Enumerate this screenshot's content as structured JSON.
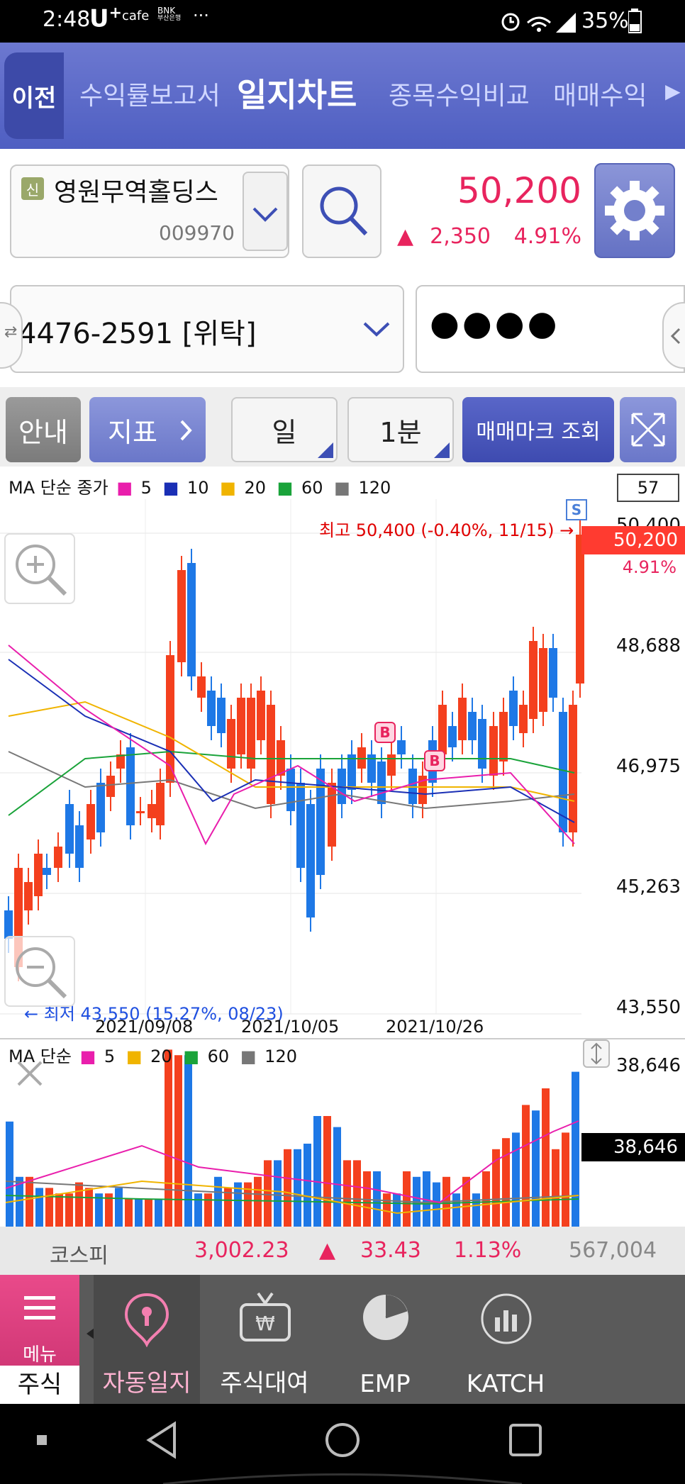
{
  "status_bar": {
    "time": "2:48",
    "carrier": "U",
    "carrier_sup": "+",
    "cafe": "cafe",
    "bnk_line1": "BNK",
    "bnk_line2": "부산은행",
    "dots": "···",
    "battery": "35%"
  },
  "top_nav": {
    "back_label": "이전",
    "tabs": [
      "수익률보고서",
      "일지차트",
      "종목수익비교",
      "매매수익"
    ],
    "active_index": 1,
    "more_glyph": "▶"
  },
  "stock": {
    "badge": "신",
    "name": "영원무역홀딩스",
    "code": "009970",
    "price": "50,200",
    "change_arrow": "▲",
    "change": "2,350",
    "change_pct": "4.91%"
  },
  "account": {
    "number": "4476-2591 [위탁]",
    "password_mask": "●●●●"
  },
  "buttons": {
    "guide": "안내",
    "indicator": "지표",
    "period": "일",
    "interval": "1분",
    "trade_mark": "매매마크 조회"
  },
  "chart": {
    "legend_prefix": "MA 단순 종가",
    "legend": [
      {
        "label": "5",
        "color": "#e91eac"
      },
      {
        "label": "10",
        "color": "#1a2fb5"
      },
      {
        "label": "20",
        "color": "#f0b400"
      },
      {
        "label": "60",
        "color": "#1aa33a"
      },
      {
        "label": "120",
        "color": "#777777"
      }
    ],
    "count_box": "57",
    "y_labels": [
      "50,400",
      "48,688",
      "46,975",
      "45,263",
      "43,550"
    ],
    "current_price_tag": "50,200",
    "current_pct": "4.91%",
    "high_note": "최고 50,400 (-0.40%, 11/15) →",
    "low_note": "← 최저 43,550 (15.27%, 08/23)",
    "x_labels": [
      "2021/09/08",
      "2021/10/05",
      "2021/10/26"
    ],
    "marker_s": "S",
    "marker_b": "B",
    "up_color": "#f4401e",
    "down_color": "#1e78e6"
  },
  "volume": {
    "legend_prefix": "MA 단순",
    "legend": [
      {
        "label": "5",
        "color": "#e91eac"
      },
      {
        "label": "20",
        "color": "#f0b400"
      },
      {
        "label": "60",
        "color": "#1aa33a"
      },
      {
        "label": "120",
        "color": "#777777"
      }
    ],
    "max_label": "38,646",
    "current_tag": "38,646"
  },
  "kospi": {
    "name": "코스피",
    "value": "3,002.23",
    "arrow": "▲",
    "change": "33.43",
    "pct": "1.13%",
    "volume": "567,004"
  },
  "bottom_menu": {
    "menu_label": "메뉴",
    "menu_sub": "주식",
    "items": [
      "자동일지",
      "주식대여",
      "EMP",
      "KATCH"
    ]
  }
}
